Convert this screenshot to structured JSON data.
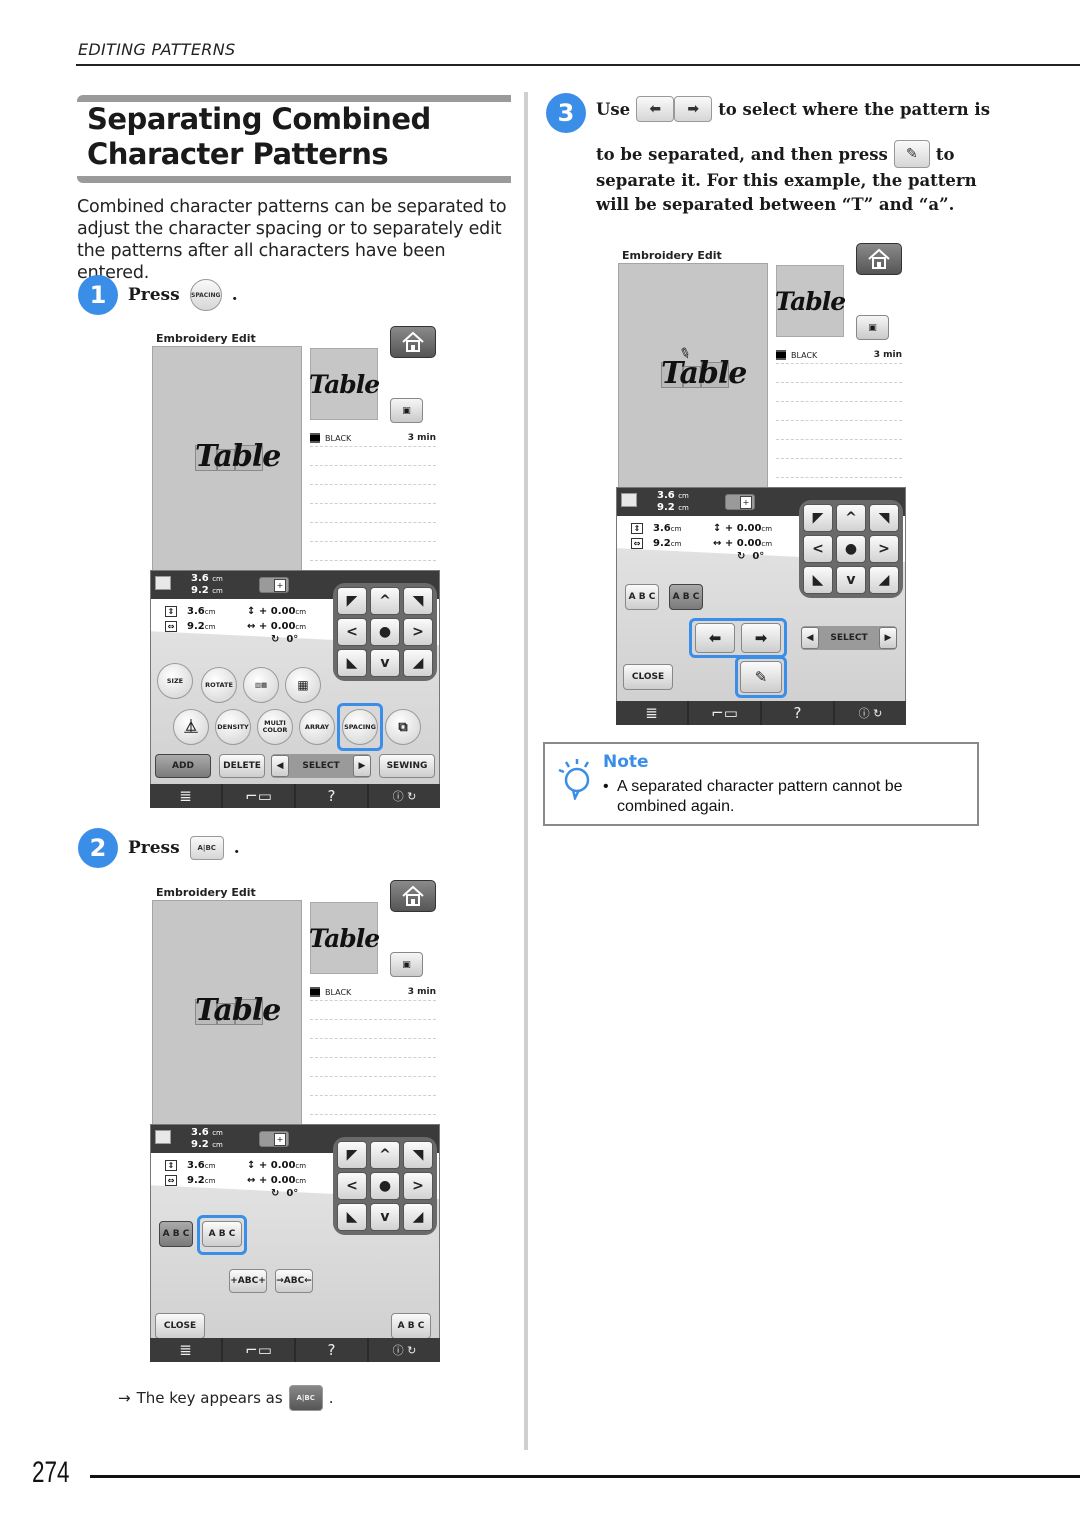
{
  "header": {
    "section": "EDITING PATTERNS"
  },
  "title": "Separating Combined Character Patterns",
  "intro": "Combined character patterns can be separated to adjust the character spacing or to separately edit the patterns after all characters have been entered.",
  "steps": [
    {
      "number": "1",
      "prefix": "Press",
      "key_label": "SPACING",
      "suffix": "."
    },
    {
      "number": "2",
      "prefix": "Press",
      "key_label": "A|BC",
      "suffix": "."
    },
    {
      "number": "3",
      "line1_prefix": "Use",
      "line1_suffix": "to select where the pattern is",
      "line2_prefix": "to be separated, and then press",
      "line2_suffix": "to",
      "line3": "separate it. For this example, the pattern",
      "line4": "will be separated between “T” and “a”."
    }
  ],
  "result_note": {
    "arrow": "→",
    "text": "The key appears as",
    "key_label": "A|BC",
    "suffix": "."
  },
  "screen": {
    "title": "Embroidery Edit",
    "pattern_text": "Table",
    "thread_color": "BLACK",
    "time": "3 min",
    "dark_height": "3.6",
    "dark_width": "9.2",
    "unit": "cm",
    "height": "3.6",
    "width": "9.2",
    "offset_v": "+ 0.00",
    "offset_h": "+ 0.00",
    "rotation": "0°",
    "dpad": [
      "◤",
      "^",
      "◥",
      "<",
      "●",
      ">",
      "◣",
      "v",
      "◢"
    ],
    "round_buttons_row1": [
      "SIZE",
      "ROTATE",
      "",
      ""
    ],
    "round_buttons_row2": [
      "",
      "DENSITY",
      "MULTI COLOR",
      "ARRAY",
      "SPACING",
      ""
    ],
    "add": "ADD",
    "delete": "DELETE",
    "select": "SELECT",
    "sewing": "SEWING",
    "close": "CLOSE",
    "spacing_key": "A B C",
    "separate_key": "A B C",
    "spacing_narrow": "+ABC+",
    "spacing_wide": "→ABC←",
    "abc_key": "A B C",
    "nav": [
      "≣",
      "⌐▭",
      "?",
      "ⓘ ↻"
    ]
  },
  "note": {
    "title": "Note",
    "items": [
      "A separated character pattern cannot be combined again."
    ]
  },
  "accent_color": "#3b8ee8",
  "page_number": "274"
}
